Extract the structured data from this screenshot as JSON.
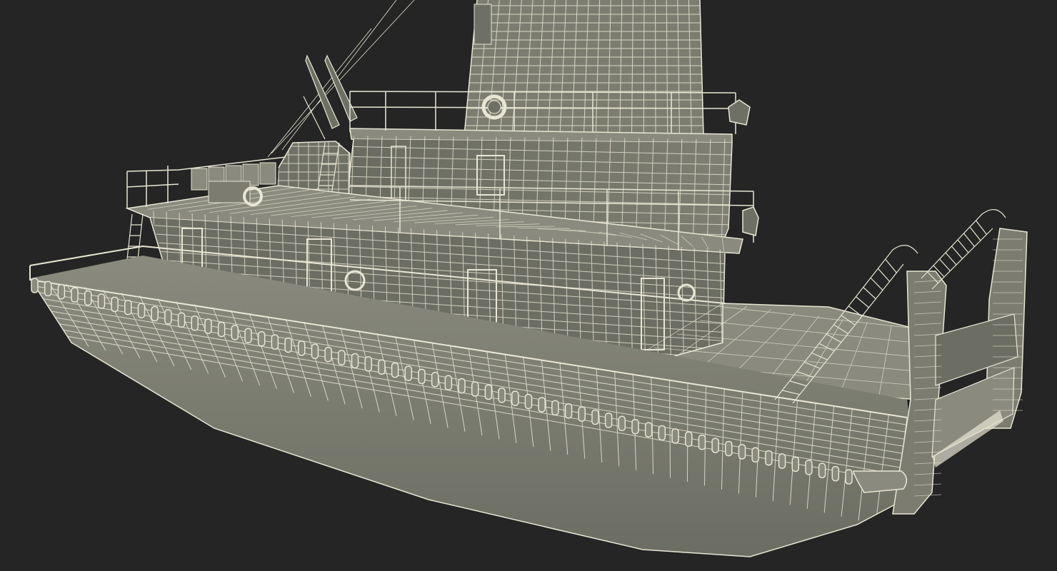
{
  "viewport": {
    "background_color": "#252525"
  },
  "model": {
    "subject": "tugboat",
    "render_style": "wireframe",
    "surface_color": "#7c7d70",
    "surface_dark_color": "#5f6056",
    "deck_color": "#8a8b7e",
    "wire_color": "#e8e6d4"
  }
}
